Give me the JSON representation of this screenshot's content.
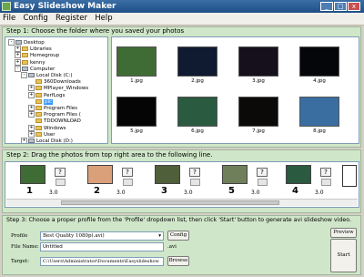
{
  "window": {
    "title": "Easy Slideshow Maker"
  },
  "menu": [
    "File",
    "Config",
    "Register",
    "Help"
  ],
  "step1": {
    "label": "Step 1: Choose the folder where you saved your photos",
    "tree": [
      {
        "label": "Desktop",
        "icon": "desktop-icon",
        "exp": "-"
      },
      {
        "label": "Libraries",
        "icon": "folder-icon",
        "exp": "+"
      },
      {
        "label": "Homegroup",
        "icon": "folder-icon",
        "exp": "+"
      },
      {
        "label": "kenny",
        "icon": "folder-icon",
        "exp": "+"
      },
      {
        "label": "Computer",
        "icon": "computer-icon",
        "exp": "-"
      },
      {
        "label": "Local Disk (C:)",
        "icon": "drive-icon",
        "exp": "-"
      },
      {
        "label": "360Downloads",
        "icon": "folder-icon",
        "exp": ""
      },
      {
        "label": "MPlayer_Windows",
        "icon": "folder-icon",
        "exp": "+"
      },
      {
        "label": "PerfLogs",
        "icon": "folder-icon",
        "exp": "+"
      },
      {
        "label": "pic",
        "icon": "folder-icon",
        "exp": "",
        "selected": true
      },
      {
        "label": "Program Files",
        "icon": "folder-icon",
        "exp": "+"
      },
      {
        "label": "Program Files (",
        "icon": "folder-icon",
        "exp": "+"
      },
      {
        "label": "TDDOWNLOAD",
        "icon": "folder-icon",
        "exp": ""
      },
      {
        "label": "Windows",
        "icon": "folder-icon",
        "exp": "+"
      },
      {
        "label": "User",
        "icon": "folder-icon",
        "exp": "+"
      },
      {
        "label": "Local Disk (D:)",
        "icon": "drive-icon",
        "exp": "+"
      }
    ],
    "photos": [
      {
        "name": "1.jpg",
        "bg": "#3f6b34"
      },
      {
        "name": "2.jpg",
        "bg": "#101a30"
      },
      {
        "name": "3.jpg",
        "bg": "#15101c"
      },
      {
        "name": "4.jpg",
        "bg": "#05060a"
      },
      {
        "name": "5.jpg",
        "bg": "#050505"
      },
      {
        "name": "6.jpg",
        "bg": "#2a5a40"
      },
      {
        "name": "7.jpg",
        "bg": "#0c0a08"
      },
      {
        "name": "8.jpg",
        "bg": "#3a6ea0"
      }
    ]
  },
  "step2": {
    "label": "Step 2: Drag the photos from top right area to the following line.",
    "slots": [
      {
        "num": "1",
        "bg": "#3f6b34",
        "dur": "3.0"
      },
      {
        "num": "2",
        "bg": "#d9a07a",
        "dur": "3.0"
      },
      {
        "num": "3",
        "bg": "#4f5f3a",
        "dur": "3.0"
      },
      {
        "num": "5",
        "bg": "#6f7f5a",
        "dur": "3.0"
      },
      {
        "num": "4",
        "bg": "#2a5a40",
        "dur": "3.0"
      }
    ],
    "gap_dur": "3.0",
    "gap_mark": "?"
  },
  "step3": {
    "label": "Step 3: Choose a proper profile from the 'Profile' dropdown list, then click 'Start' button to generate avi slideshow video.",
    "profile_label": "Profile",
    "profile_value": "Best Quality 1080p(.avi)",
    "config_button": "Config",
    "filename_label": "File Name:",
    "filename_value": "Untitled",
    "filename_ext": ".avi",
    "target_label": "Target:",
    "target_value": "C:\\Users\\Administrator\\Documents\\Easyslideshow",
    "browse_button": "Browse",
    "preview_button": "Preview",
    "start_button": "Start"
  },
  "colors": {
    "panel_green": "#cfe6c8",
    "titlebar_blue": "#1e4f86"
  }
}
